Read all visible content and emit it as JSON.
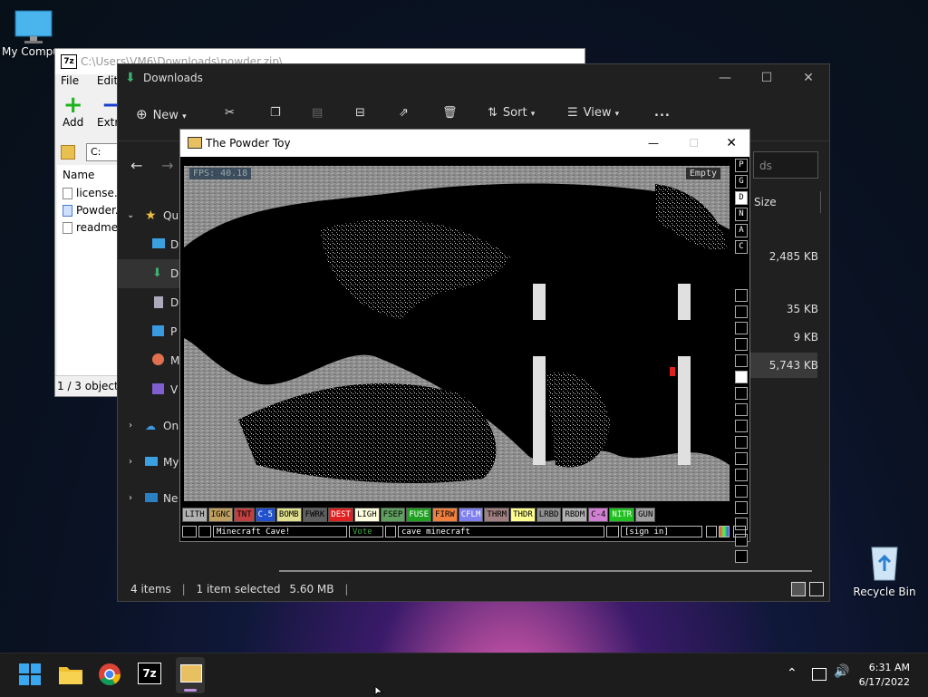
{
  "desktop": {
    "my_computer": "My Compu",
    "recycle_bin": "Recycle Bin"
  },
  "sevenzip": {
    "title": "C:\\Users\\VM6\\Downloads\\powder.zip\\",
    "menu": [
      "File",
      "Edit"
    ],
    "toolbar": {
      "add": "Add",
      "extract": "Extra"
    },
    "address": "C:",
    "column_name": "Name",
    "files": [
      "license.t",
      "Powder.e",
      "readme.t"
    ],
    "status": "1 / 3 object(s"
  },
  "explorer": {
    "title": "Downloads",
    "cmd": {
      "new": "New",
      "sort": "Sort",
      "view": "View",
      "more": "..."
    },
    "search_placeholder": "ds",
    "column_size": "Size",
    "nav": {
      "quick_access": "Qu",
      "items": [
        "D",
        "D",
        "D",
        "P",
        "M",
        "V"
      ],
      "onedrive": "On",
      "mypc": "My",
      "network": "Ne"
    },
    "sizes": [
      "2,485 KB",
      "35 KB",
      "9 KB",
      "5,743 KB"
    ],
    "status": {
      "items": "4 items",
      "selected": "1 item selected",
      "size": "5.60 MB"
    }
  },
  "powdertoy": {
    "title": "The Powder Toy",
    "fps": "FPS: 40.18",
    "hover": "Empty",
    "side_letters": [
      "P",
      "G",
      "D",
      "N",
      "A",
      "C"
    ],
    "elements": [
      {
        "label": "LITH",
        "color": "#b0b0b0"
      },
      {
        "label": "IGNC",
        "color": "#c0a060"
      },
      {
        "label": "TNT",
        "color": "#c04040"
      },
      {
        "label": "C-5",
        "color": "#2050d0"
      },
      {
        "label": "BOMB",
        "color": "#e0e090"
      },
      {
        "label": "FWRK",
        "color": "#606060"
      },
      {
        "label": "DEST",
        "color": "#e02020"
      },
      {
        "label": "LIGH",
        "color": "#ffffe0"
      },
      {
        "label": "FSEP",
        "color": "#60a060"
      },
      {
        "label": "FUSE",
        "color": "#20a020"
      },
      {
        "label": "FIRW",
        "color": "#f08040"
      },
      {
        "label": "CFLM",
        "color": "#8080f0"
      },
      {
        "label": "THRM",
        "color": "#a08080"
      },
      {
        "label": "THDR",
        "color": "#ffff90"
      },
      {
        "label": "LRBD",
        "color": "#909090"
      },
      {
        "label": "RBDM",
        "color": "#b0b0b0"
      },
      {
        "label": "C-4",
        "color": "#d080d0"
      },
      {
        "label": "NITR",
        "color": "#20c020"
      },
      {
        "label": "GUN",
        "color": "#a0a0a0"
      }
    ],
    "save_name": "Minecraft Cave!",
    "vote": "Vote",
    "tags": "cave minecraft",
    "sign_in": "[sign in]"
  },
  "clock": {
    "time": "6:31 AM",
    "date": "6/17/2022"
  }
}
